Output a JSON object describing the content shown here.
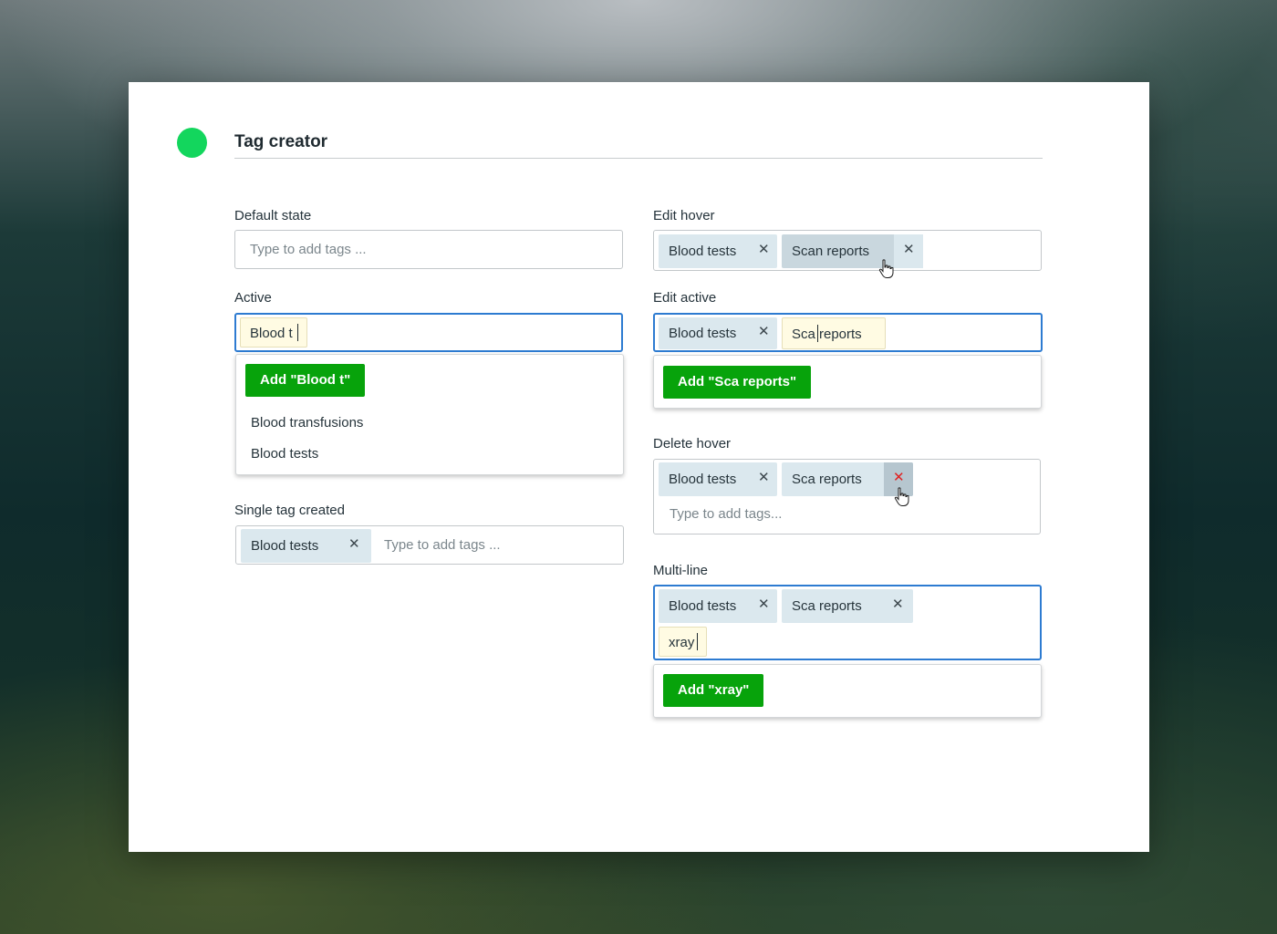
{
  "header": {
    "title": "Tag creator"
  },
  "sections": {
    "default_state": {
      "label": "Default state",
      "placeholder": "Type to add tags ..."
    },
    "active": {
      "label": "Active",
      "typed": "Blood t",
      "add_button": "Add \"Blood t\"",
      "options": [
        "Blood transfusions",
        "Blood tests"
      ]
    },
    "single_tag": {
      "label": "Single tag created",
      "tags": [
        "Blood tests"
      ],
      "placeholder": "Type to add tags ..."
    },
    "edit_hover": {
      "label": "Edit hover",
      "tags": [
        "Blood tests",
        "Scan reports"
      ]
    },
    "edit_active": {
      "label": "Edit active",
      "tags": [
        "Blood tests"
      ],
      "editing_before": "Sca",
      "editing_after": "reports",
      "add_button": "Add \"Sca reports\""
    },
    "delete_hover": {
      "label": "Delete hover",
      "tags": [
        "Blood tests",
        "Sca reports"
      ],
      "placeholder": "Type to add tags..."
    },
    "multi_line": {
      "label": "Multi-line",
      "tags": [
        "Blood tests",
        "Sca reports"
      ],
      "typed": "xray",
      "add_button": "Add \"xray\""
    }
  },
  "icons": {
    "remove": "close-icon",
    "pointer": "hand-pointer-icon"
  },
  "colors": {
    "accent_green": "#07a30b",
    "status_dot": "#13d65d",
    "focus_border": "#2d7bd1",
    "tag_bg": "#dbe8ee",
    "delete_red": "#e02020"
  }
}
